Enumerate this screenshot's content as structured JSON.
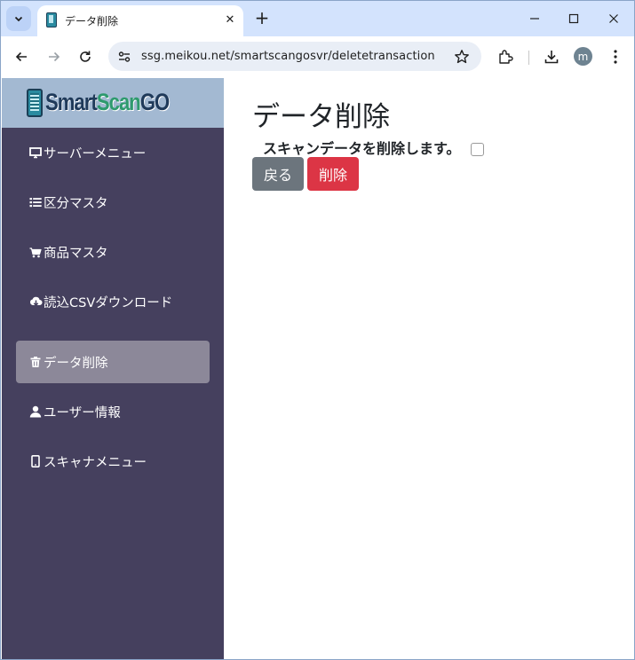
{
  "browser": {
    "tab_title": "データ削除",
    "tab_close": "✕",
    "new_tab": "+",
    "url": "ssg.meikou.net/smartscangosvr/deletetransaction",
    "avatar_initial": "m"
  },
  "sidebar": {
    "brand": {
      "part1": "Smart",
      "part2": "Scan",
      "part3": "GO"
    },
    "items": [
      {
        "label": "サーバーメニュー",
        "icon": "monitor-icon",
        "active": false
      },
      {
        "label": "区分マスタ",
        "icon": "list-icon",
        "active": false
      },
      {
        "label": "商品マスタ",
        "icon": "cart-icon",
        "active": false
      },
      {
        "label": "読込CSVダウンロード",
        "icon": "cloud-download-icon",
        "active": false
      },
      {
        "label": "データ削除",
        "icon": "trash-icon",
        "active": true
      },
      {
        "label": "ユーザー情報",
        "icon": "person-icon",
        "active": false
      },
      {
        "label": "スキャナメニュー",
        "icon": "phone-icon",
        "active": false
      }
    ]
  },
  "main": {
    "title": "データ削除",
    "confirm_label": "スキャンデータを削除します。",
    "confirm_checked": false,
    "back_button": "戻る",
    "delete_button": "削除"
  },
  "colors": {
    "sidebar_bg": "#45405e",
    "brand_bg": "#a3b9d2",
    "active_item_bg": "#8c8899",
    "back_button_bg": "#6c757d",
    "delete_button_bg": "#dc3545",
    "tabbar_bg": "#d3e3fd"
  }
}
